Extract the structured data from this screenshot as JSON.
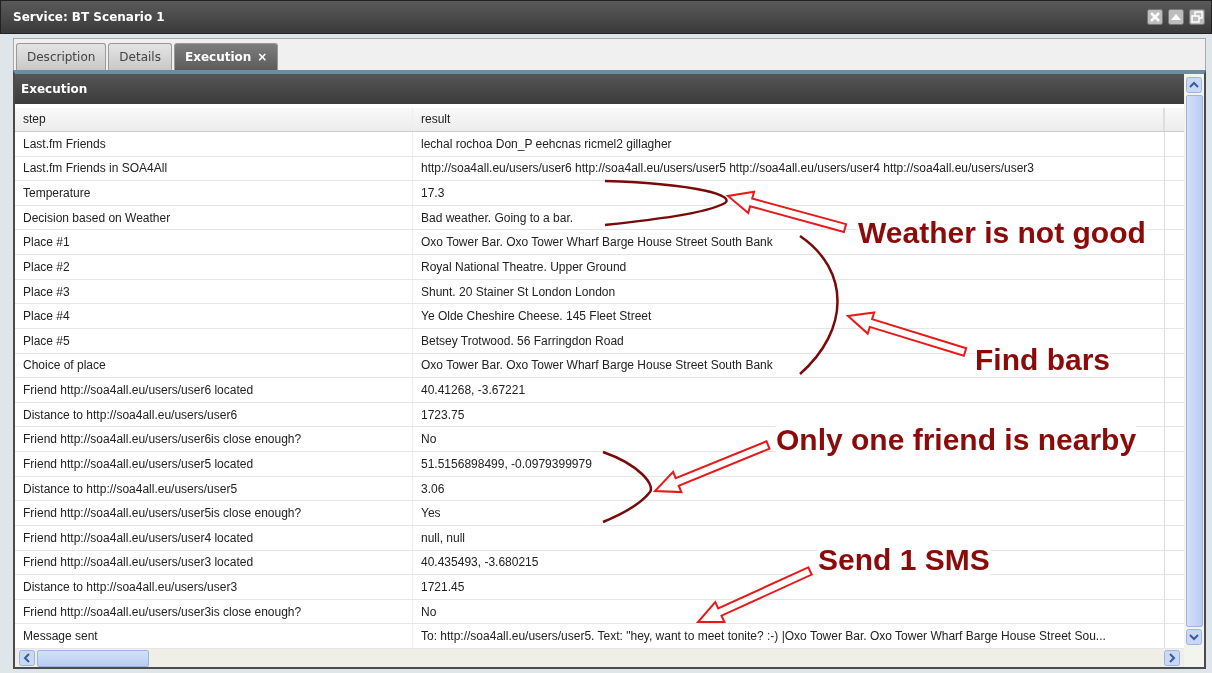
{
  "window": {
    "title": "Service: BT Scenario 1"
  },
  "tabs": [
    {
      "label": "Description",
      "selected": false
    },
    {
      "label": "Details",
      "selected": false
    },
    {
      "label": "Execution",
      "selected": true,
      "close_glyph": "×"
    }
  ],
  "panel": {
    "title": "Execution"
  },
  "table": {
    "columns": [
      "step",
      "result"
    ],
    "rows": [
      [
        "Last.fm Friends",
        "lechal rochoa Don_P eehcnas ricmel2 gillagher"
      ],
      [
        "Last.fm Friends in SOA4All",
        "http://soa4all.eu/users/user6 http://soa4all.eu/users/user5 http://soa4all.eu/users/user4 http://soa4all.eu/users/user3"
      ],
      [
        "Temperature",
        "17.3"
      ],
      [
        "Decision based on Weather",
        "Bad weather. Going to a bar."
      ],
      [
        "Place #1",
        "Oxo Tower Bar. Oxo Tower Wharf Barge House Street South Bank"
      ],
      [
        "Place #2",
        "Royal National Theatre. Upper Ground"
      ],
      [
        "Place #3",
        "Shunt. 20 Stainer St London London"
      ],
      [
        "Place #4",
        "Ye Olde Cheshire Cheese. 145 Fleet Street"
      ],
      [
        "Place #5",
        "Betsey Trotwood. 56 Farringdon Road"
      ],
      [
        "Choice of place",
        "Oxo Tower Bar. Oxo Tower Wharf Barge House Street South Bank"
      ],
      [
        "Friend http://soa4all.eu/users/user6 located",
        "40.41268, -3.67221"
      ],
      [
        "Distance to http://soa4all.eu/users/user6",
        "1723.75"
      ],
      [
        "Friend http://soa4all.eu/users/user6is close enough?",
        "No"
      ],
      [
        "Friend http://soa4all.eu/users/user5 located",
        "51.5156898499, -0.0979399979"
      ],
      [
        "Distance to http://soa4all.eu/users/user5",
        "3.06"
      ],
      [
        "Friend http://soa4all.eu/users/user5is close enough?",
        "Yes"
      ],
      [
        "Friend http://soa4all.eu/users/user4 located",
        "null, null"
      ],
      [
        "Friend http://soa4all.eu/users/user3 located",
        "40.435493, -3.680215"
      ],
      [
        "Distance to http://soa4all.eu/users/user3",
        "1721.45"
      ],
      [
        "Friend http://soa4all.eu/users/user3is close enough?",
        "No"
      ],
      [
        "Message sent",
        "To: http://soa4all.eu/users/user5. Text: \"hey, want to meet tonite? :-) |Oxo Tower Bar. Oxo Tower Wharf Barge House Street Sou..."
      ]
    ]
  },
  "annotations": [
    {
      "text": "Weather is not good"
    },
    {
      "text": "Find bars"
    },
    {
      "text": "Only one friend is nearby"
    },
    {
      "text": "Send 1 SMS"
    }
  ]
}
